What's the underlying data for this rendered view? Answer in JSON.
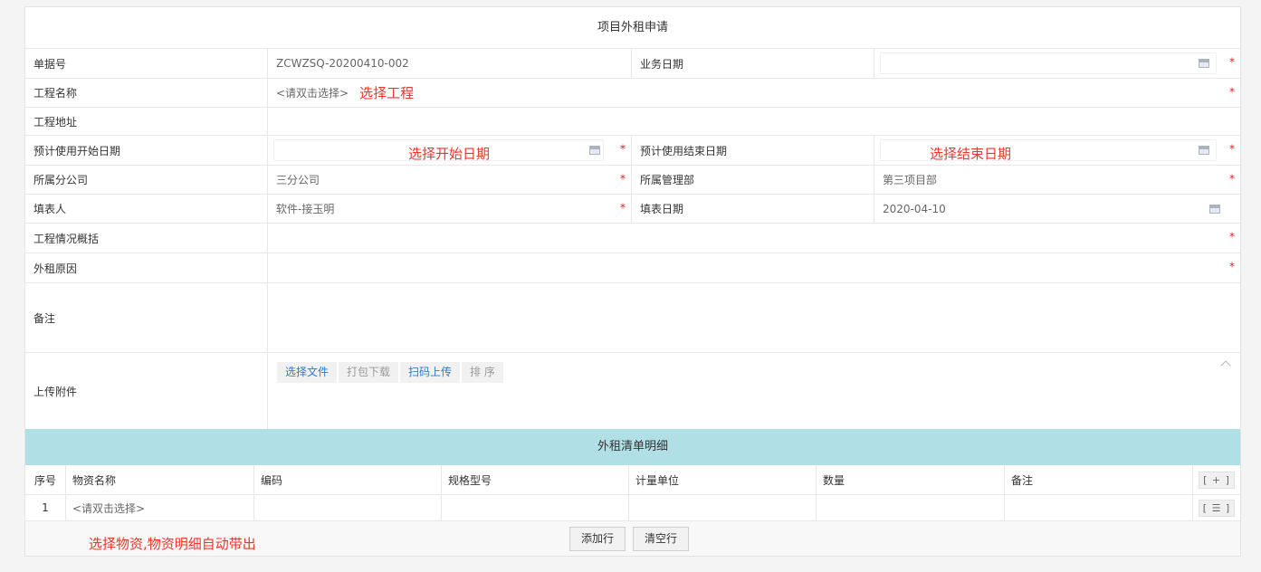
{
  "form": {
    "title": "项目外租申请",
    "fields": {
      "doc_no": {
        "label": "单据号",
        "value": "ZCWZSQ-20200410-002"
      },
      "biz_date": {
        "label": "业务日期",
        "value": ""
      },
      "project_name": {
        "label": "工程名称",
        "placeholder": "<请双击选择>",
        "annotation": "选择工程"
      },
      "project_address": {
        "label": "工程地址",
        "value": ""
      },
      "start_date": {
        "label": "预计使用开始日期",
        "value": "",
        "annotation": "选择开始日期"
      },
      "end_date": {
        "label": "预计使用结束日期",
        "value": "",
        "annotation": "选择结束日期"
      },
      "branch": {
        "label": "所属分公司",
        "value": "三分公司"
      },
      "dept": {
        "label": "所属管理部",
        "value": "第三项目部"
      },
      "filler": {
        "label": "填表人",
        "value": "软件-接玉明"
      },
      "fill_date": {
        "label": "填表日期",
        "value": "2020-04-10"
      },
      "overview": {
        "label": "工程情况概括",
        "value": ""
      },
      "reason": {
        "label": "外租原因",
        "value": ""
      },
      "remark": {
        "label": "备注",
        "value": ""
      },
      "attachment": {
        "label": "上传附件",
        "buttons": [
          "选择文件",
          "打包下载",
          "扫码上传",
          "排 序"
        ]
      }
    },
    "required_mark": "*"
  },
  "detail": {
    "title": "外租清单明细",
    "columns": [
      "序号",
      "物资名称",
      "编码",
      "规格型号",
      "计量单位",
      "数量",
      "备注"
    ],
    "add_col_btn": "[ + ]",
    "rows": [
      {
        "seq": "1",
        "name_placeholder": "<请双击选择>",
        "code": "",
        "spec": "",
        "unit": "",
        "qty": "",
        "note": "",
        "op": "[ ☰ ]"
      }
    ],
    "add_row_label": "添加行",
    "clear_rows_label": "清空行",
    "annotation": "选择物资,物资明细自动带出"
  },
  "colors": {
    "annotation": "#e8372c",
    "required": "#e02020",
    "subheader_bg": "#b0dfe5",
    "link_blue": "#2b7cc9"
  }
}
